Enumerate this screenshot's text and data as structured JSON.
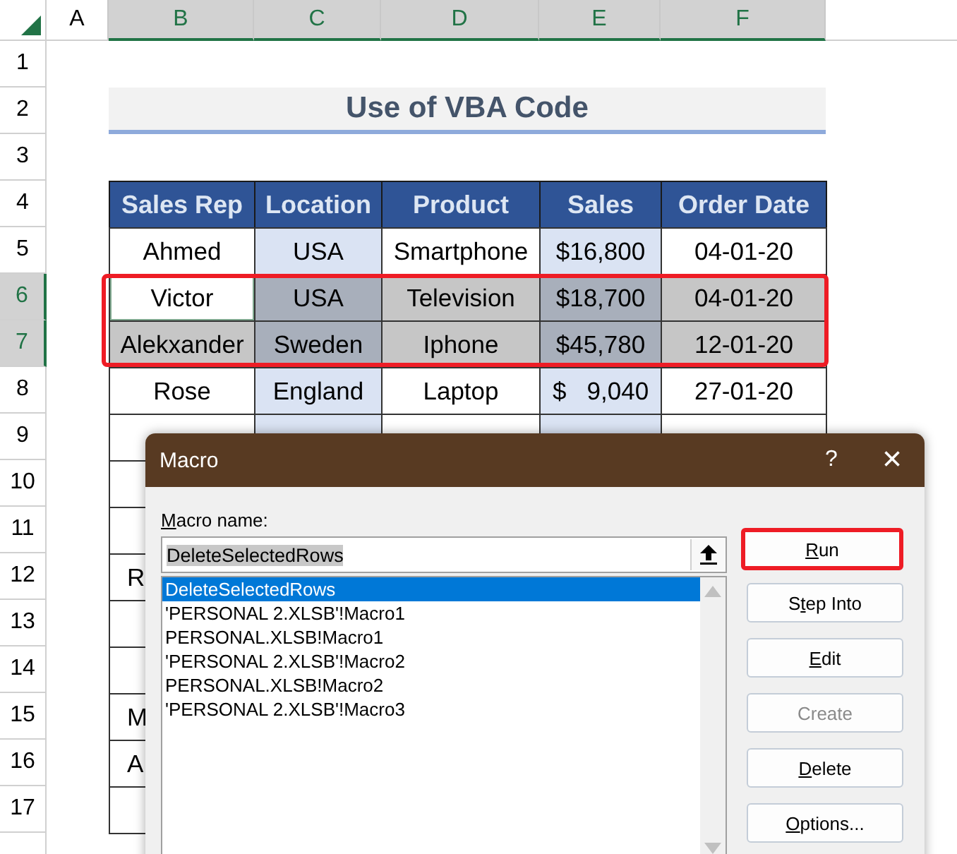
{
  "sheet": {
    "columns": [
      {
        "label": "A",
        "selected": false
      },
      {
        "label": "B",
        "selected": true
      },
      {
        "label": "C",
        "selected": true
      },
      {
        "label": "D",
        "selected": true
      },
      {
        "label": "E",
        "selected": true
      },
      {
        "label": "F",
        "selected": true
      }
    ],
    "rows": [
      {
        "label": "1",
        "selected": false
      },
      {
        "label": "2",
        "selected": false
      },
      {
        "label": "3",
        "selected": false
      },
      {
        "label": "4",
        "selected": false
      },
      {
        "label": "5",
        "selected": false
      },
      {
        "label": "6",
        "selected": true
      },
      {
        "label": "7",
        "selected": true
      },
      {
        "label": "8",
        "selected": false
      },
      {
        "label": "9",
        "selected": false
      },
      {
        "label": "10",
        "selected": false
      },
      {
        "label": "11",
        "selected": false
      },
      {
        "label": "12",
        "selected": false
      },
      {
        "label": "13",
        "selected": false
      },
      {
        "label": "14",
        "selected": false
      },
      {
        "label": "15",
        "selected": false
      },
      {
        "label": "16",
        "selected": false
      },
      {
        "label": "17",
        "selected": false
      }
    ]
  },
  "title": "Use of VBA Code",
  "table": {
    "columns": [
      {
        "label": "Sales Rep",
        "shaded": false
      },
      {
        "label": "Location",
        "shaded": true
      },
      {
        "label": "Product",
        "shaded": false
      },
      {
        "label": "Sales",
        "shaded": true
      },
      {
        "label": "Order Date",
        "shaded": false
      }
    ],
    "rows": [
      {
        "selected": false,
        "cells": [
          {
            "text": "Ahmed",
            "active": false
          },
          {
            "text": "USA",
            "active": false
          },
          {
            "text": "Smartphone",
            "active": false
          },
          {
            "text": "$16,800",
            "active": false
          },
          {
            "text": "04-01-20",
            "active": false
          }
        ]
      },
      {
        "selected": true,
        "cells": [
          {
            "text": "Victor",
            "active": true
          },
          {
            "text": "USA",
            "active": false
          },
          {
            "text": "Television",
            "active": false
          },
          {
            "text": "$18,700",
            "active": false
          },
          {
            "text": "04-01-20",
            "active": false
          }
        ]
      },
      {
        "selected": true,
        "cells": [
          {
            "text": "Alekxander",
            "active": false
          },
          {
            "text": "Sweden",
            "active": false
          },
          {
            "text": "Iphone",
            "active": false
          },
          {
            "text": "$45,780",
            "active": false
          },
          {
            "text": "12-01-20",
            "active": false
          }
        ]
      },
      {
        "selected": false,
        "cells": [
          {
            "text": "Rose",
            "active": false
          },
          {
            "text": "England",
            "active": false
          },
          {
            "text": "Laptop",
            "active": false
          },
          {
            "text": "$   9,040",
            "active": false
          },
          {
            "text": "27-01-20",
            "active": false
          }
        ]
      },
      {
        "selected": false
      },
      {
        "selected": false
      },
      {
        "selected": false
      },
      {
        "selected": false,
        "cells": [
          {
            "text": "R"
          }
        ]
      },
      {
        "selected": false
      },
      {
        "selected": false
      },
      {
        "selected": false,
        "cells": [
          {
            "text": "M"
          }
        ]
      },
      {
        "selected": false,
        "cells": [
          {
            "text": "A"
          }
        ]
      },
      {
        "selected": false
      }
    ]
  },
  "dialog": {
    "title": "Macro",
    "help": "?",
    "close": "×",
    "name_label": {
      "key": "M",
      "after": "acro name:"
    },
    "name_value": "DeleteSelectedRows",
    "macros": [
      {
        "label": "DeleteSelectedRows",
        "selected": true
      },
      {
        "label": "'PERSONAL 2.XLSB'!Macro1",
        "selected": false
      },
      {
        "label": "PERSONAL.XLSB!Macro1",
        "selected": false
      },
      {
        "label": "'PERSONAL 2.XLSB'!Macro2",
        "selected": false
      },
      {
        "label": "PERSONAL.XLSB!Macro2",
        "selected": false
      },
      {
        "label": "'PERSONAL 2.XLSB'!Macro3",
        "selected": false
      }
    ],
    "buttons": [
      {
        "key": "R",
        "after": "un",
        "disabled": false,
        "highlighted": true
      },
      {
        "before": "S",
        "key": "t",
        "after": "ep Into",
        "disabled": false,
        "highlighted": false
      },
      {
        "key": "E",
        "after": "dit",
        "disabled": false,
        "highlighted": false
      },
      {
        "after": "Create",
        "disabled": true,
        "highlighted": false
      },
      {
        "key": "D",
        "after": "elete",
        "disabled": false,
        "highlighted": false
      },
      {
        "key": "O",
        "after": "ptions...",
        "disabled": false,
        "highlighted": false
      }
    ]
  }
}
